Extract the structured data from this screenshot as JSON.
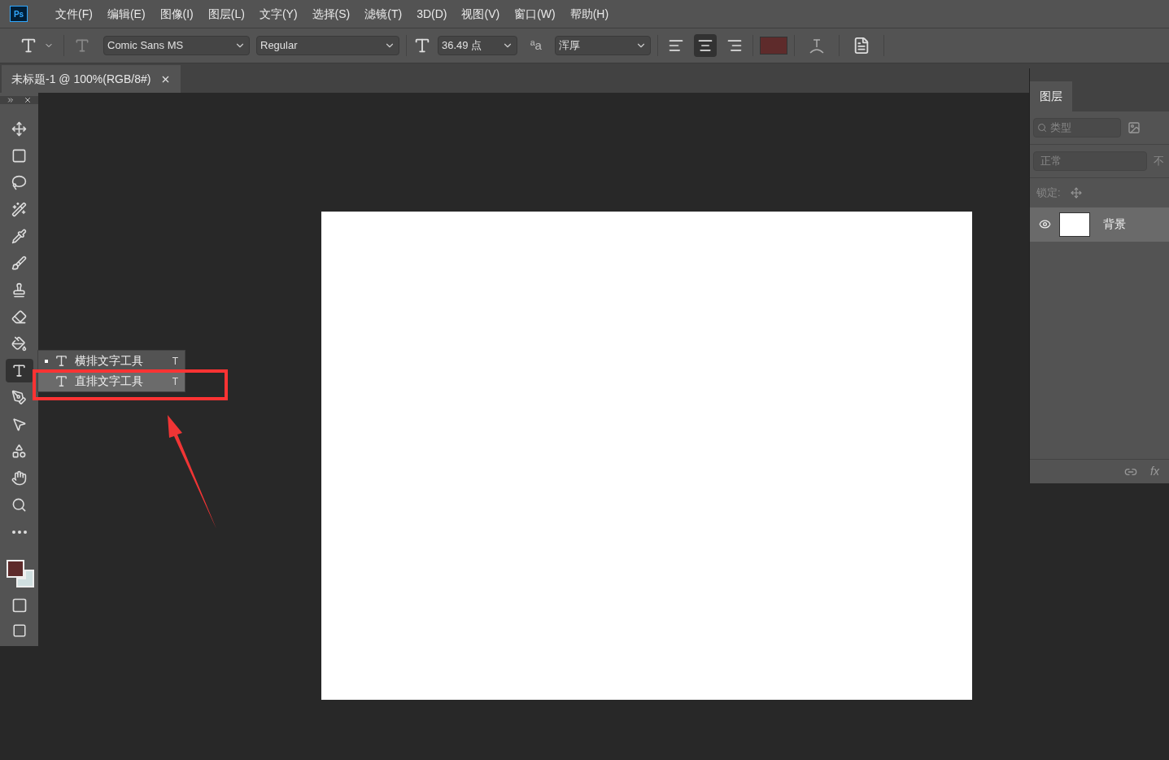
{
  "app_logo": "Ps",
  "menu": [
    "文件(F)",
    "编辑(E)",
    "图像(I)",
    "图层(L)",
    "文字(Y)",
    "选择(S)",
    "滤镜(T)",
    "3D(D)",
    "视图(V)",
    "窗口(W)",
    "帮助(H)"
  ],
  "options_bar": {
    "font_family": "Comic Sans MS",
    "font_style": "Regular",
    "font_size": "36.49 点",
    "antialias_glyph": "ªa",
    "antialias": "浑厚",
    "alignment": [
      {
        "kind": "left",
        "selected": false
      },
      {
        "kind": "center",
        "selected": true
      },
      {
        "kind": "right",
        "selected": false
      }
    ]
  },
  "document_tab": {
    "title": "未标题-1 @ 100%(RGB/8#)"
  },
  "tools": [
    {
      "kind": "move",
      "selected": false
    },
    {
      "kind": "marquee",
      "selected": false
    },
    {
      "kind": "lasso",
      "selected": false
    },
    {
      "kind": "wand",
      "selected": false
    },
    {
      "kind": "eyedropper",
      "selected": false
    },
    {
      "kind": "brush",
      "selected": false
    },
    {
      "kind": "stamp",
      "selected": false
    },
    {
      "kind": "eraser",
      "selected": false
    },
    {
      "kind": "bucket",
      "selected": false
    },
    {
      "kind": "type",
      "selected": true
    },
    {
      "kind": "pen",
      "selected": false
    },
    {
      "kind": "pointer",
      "selected": false
    },
    {
      "kind": "shape",
      "selected": false
    },
    {
      "kind": "hand",
      "selected": false
    },
    {
      "kind": "zoom",
      "selected": false
    },
    {
      "kind": "more",
      "selected": false
    }
  ],
  "tool_flyout": [
    {
      "label": "横排文字工具",
      "shortcut": "T",
      "current": true,
      "hovered": false
    },
    {
      "label": "直排文字工具",
      "shortcut": "T",
      "current": false,
      "hovered": true
    }
  ],
  "layers_panel": {
    "tab": "图层",
    "filter_placeholder": "类型",
    "blend_mode": "正常",
    "opacity_label": "不",
    "lock_label": "锁定:",
    "layers": [
      {
        "name": "背景",
        "visible": true,
        "selected": true
      }
    ],
    "fx_label": "fx"
  }
}
